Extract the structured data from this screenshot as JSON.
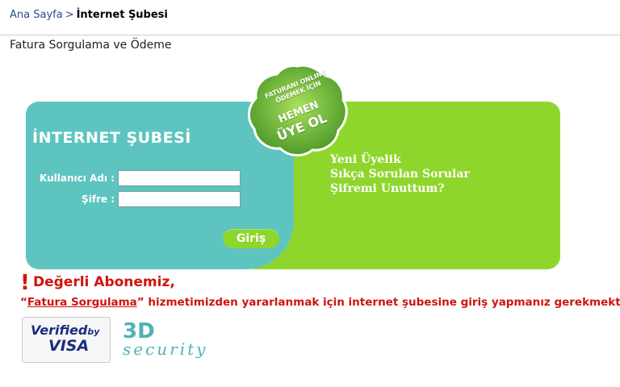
{
  "breadcrumb": {
    "home": "Ana Sayfa",
    "separator": ">",
    "current": "İnternet Şubesi"
  },
  "page": {
    "title": "Fatura Sorgulama ve Ödeme"
  },
  "login": {
    "title": "İNTERNET ŞUBESİ",
    "username_label": "Kullanıcı Adı :",
    "password_label": "Şifre :",
    "username_value": "",
    "password_value": "",
    "submit_label": "Giriş"
  },
  "links": {
    "new_member": "Yeni Üyelik",
    "faq": "Sıkça Sorulan Sorular",
    "forgot_password": "Şifremi Unuttum?"
  },
  "badge": {
    "line1": "FATURANI ONLINE ÖDEMEK İÇİN",
    "line2": "HEMEN",
    "line3": "ÜYE OL"
  },
  "notice": {
    "icon": "!",
    "title": "Değerli Abonemiz,",
    "quote_open": "“",
    "link_text": "Fatura Sorgulama",
    "quote_close": "”",
    "body": " hizmetimizden yararlanmak için internet şubesine giriş yapmanız gerekmektedir."
  },
  "security": {
    "visa_verified": "Verified",
    "visa_by": "by",
    "visa_word": "VISA",
    "secure_3d": "3D",
    "secure_word": "security"
  },
  "colors": {
    "teal_panel": "#5ec4c0",
    "green_panel": "#8fd62c",
    "alert_red": "#d0140f",
    "link_blue": "#2a4b8d"
  }
}
